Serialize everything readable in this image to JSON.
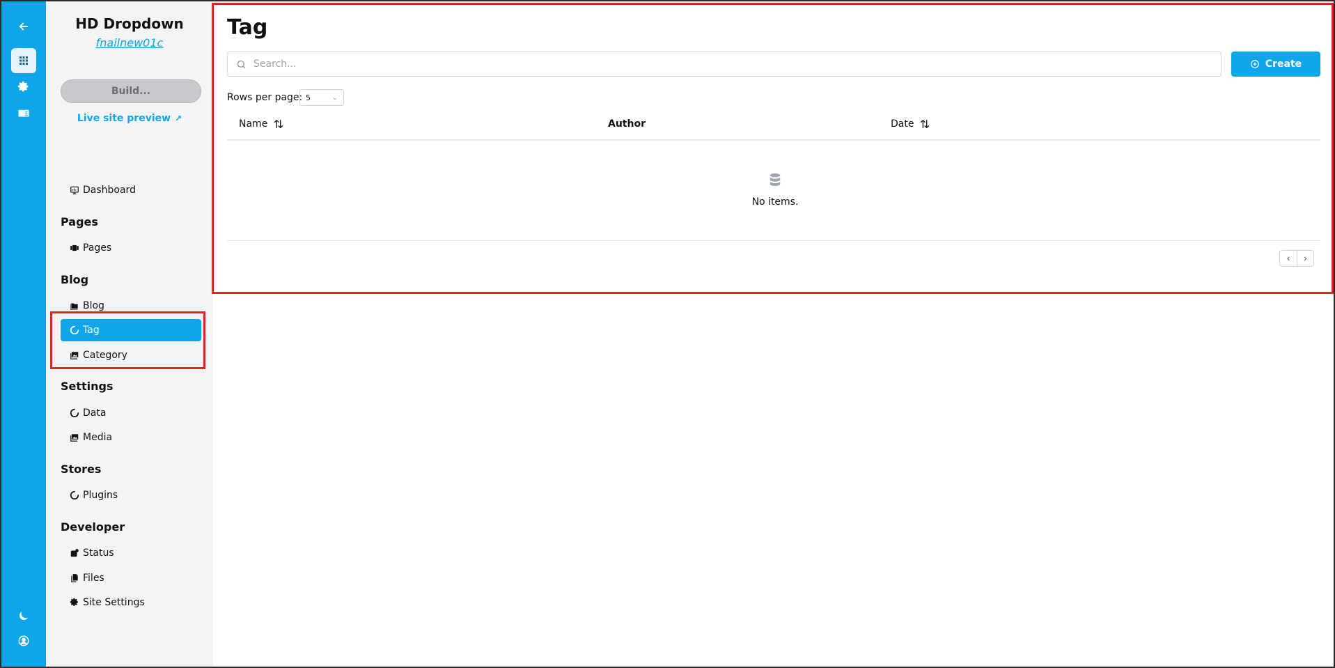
{
  "rail": {
    "icons": [
      "back-arrow-icon",
      "apps-grid-icon",
      "gear-icon",
      "book-icon",
      "moon-icon",
      "user-icon"
    ]
  },
  "sidebar": {
    "site_title": "HD Dropdown",
    "site_subtitle": "fnailnew01c",
    "build_label": "Build...",
    "preview_label": "Live site preview",
    "preview_arrow": "↗",
    "dashboard_label": "Dashboard",
    "sections": {
      "pages": "Pages",
      "blog": "Blog",
      "settings": "Settings",
      "stores": "Stores",
      "developer": "Developer"
    },
    "items": {
      "pages": "Pages",
      "blog": "Blog",
      "tag": "Tag",
      "category": "Category",
      "data": "Data",
      "media": "Media",
      "plugins": "Plugins",
      "status": "Status",
      "files": "Files",
      "site_settings": "Site Settings"
    },
    "active_item": "Tag"
  },
  "main": {
    "title": "Tag",
    "search_placeholder": "Search...",
    "search_value": "",
    "create_label": "Create",
    "rows_per_page_label": "Rows per page:",
    "rows_per_page_value": "5",
    "columns": [
      "Name",
      "Author",
      "Date"
    ],
    "empty_text": "No items.",
    "pager": {
      "prev": "‹",
      "next": "›"
    }
  },
  "colors": {
    "accent": "#0ea5e9",
    "sidebar_bg": "#f3f4f6",
    "highlight": "#dc2626"
  }
}
